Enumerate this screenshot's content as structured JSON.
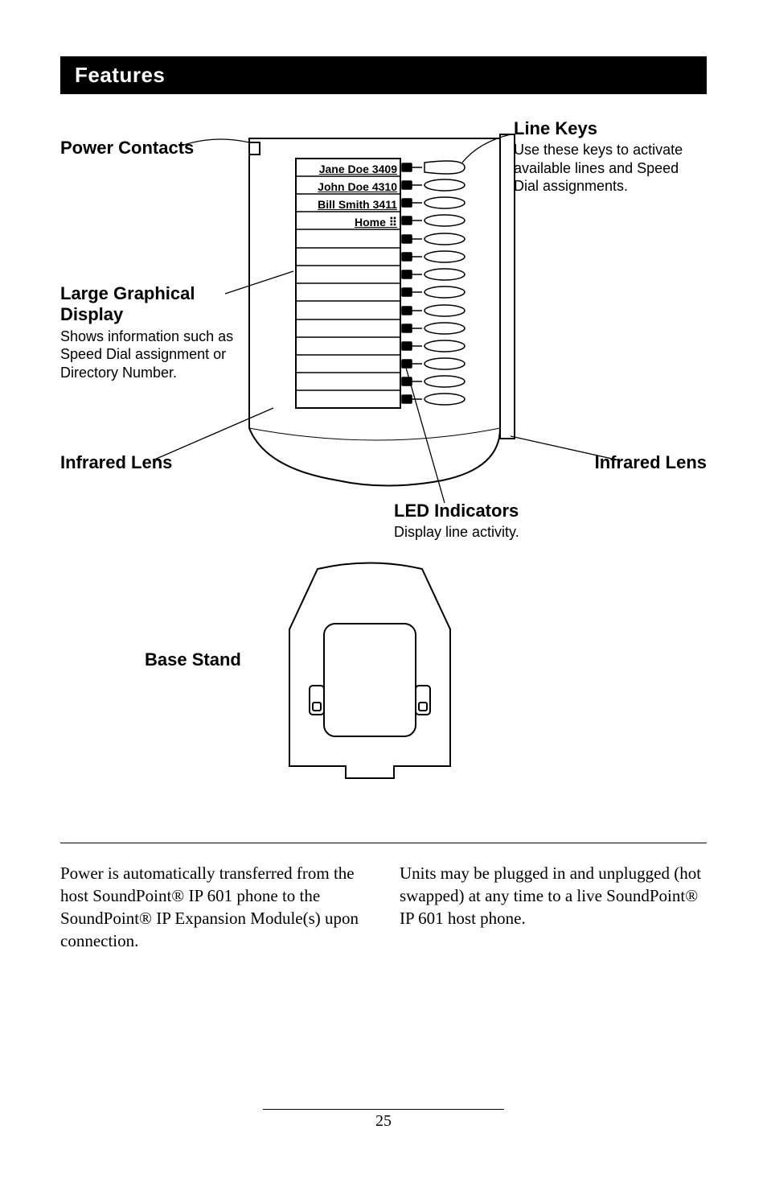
{
  "section_title": "Features",
  "callouts": {
    "power_contacts": {
      "title": "Power Contacts"
    },
    "line_keys": {
      "title": "Line Keys",
      "desc": "Use these keys to activate available lines and Speed Dial assignments."
    },
    "large_display": {
      "title": "Large Graphical Display",
      "desc": "Shows information such as Speed Dial assignment or Directory Number."
    },
    "infrared_left": {
      "title": "Infrared Lens"
    },
    "infrared_right": {
      "title": "Infrared Lens"
    },
    "led_ind": {
      "title": "LED Indicators",
      "desc": "Display line activity."
    },
    "base_stand": {
      "title": "Base Stand"
    }
  },
  "display_lines": [
    "Jane Doe 3409",
    "John Doe 4310",
    "Bill Smith 3411",
    "Home ⠿"
  ],
  "body": {
    "col1": "Power is automatically transferred from the host SoundPoint® IP 601 phone to the SoundPoint® IP Expansion Module(s) upon connection.",
    "col2": "Units may be plugged in and unplugged (hot swapped) at any time to a live Sound­Point® IP 601 host phone."
  },
  "page_number": "25"
}
